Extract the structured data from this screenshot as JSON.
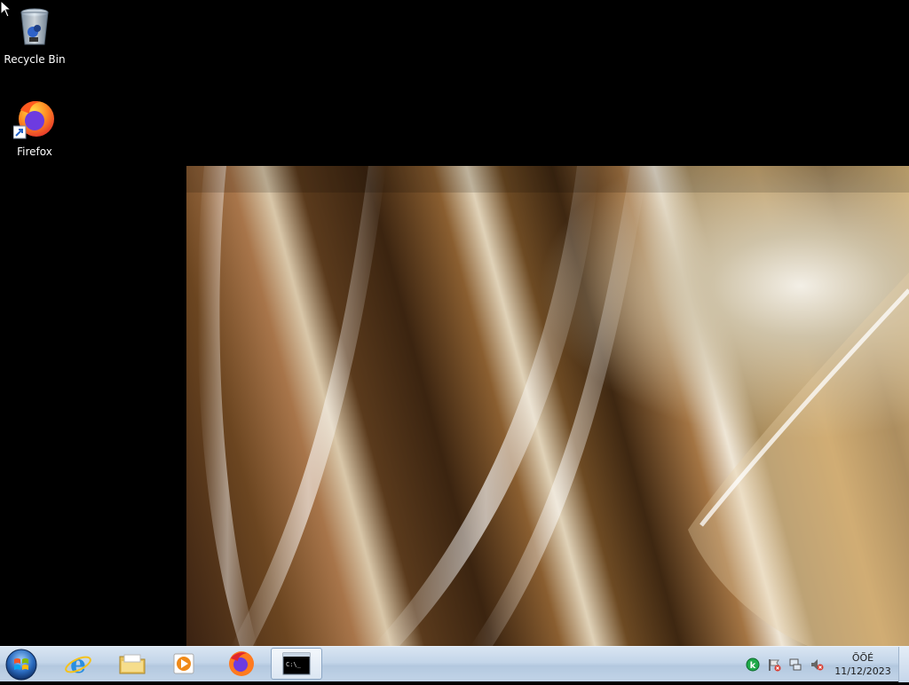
{
  "desktop": {
    "icons": [
      {
        "label": "Recycle Bin",
        "icon": "recycle-bin-icon"
      },
      {
        "label": "Firefox",
        "icon": "firefox-icon"
      }
    ]
  },
  "taskbar": {
    "start": {
      "icon": "windows-start-icon"
    },
    "pinned": [
      {
        "name": "internet-explorer",
        "icon": "internet-explorer-icon"
      },
      {
        "name": "file-explorer",
        "icon": "folder-icon"
      },
      {
        "name": "media-player",
        "icon": "media-player-icon"
      },
      {
        "name": "firefox",
        "icon": "firefox-icon"
      },
      {
        "name": "command-prompt",
        "icon": "command-prompt-icon",
        "active": true
      }
    ],
    "cmd_glyph": "C:\\_",
    "tray": {
      "icons": [
        "kaspersky-icon",
        "action-center-flag-icon",
        "network-icon",
        "volume-muted-icon"
      ],
      "time": "ÕÕÉ",
      "date": "11/12/2023"
    }
  },
  "colors": {
    "taskbar_top": "#d9e5f2",
    "taskbar_bottom": "#c2d4e8",
    "desktop_bg": "#000000"
  }
}
